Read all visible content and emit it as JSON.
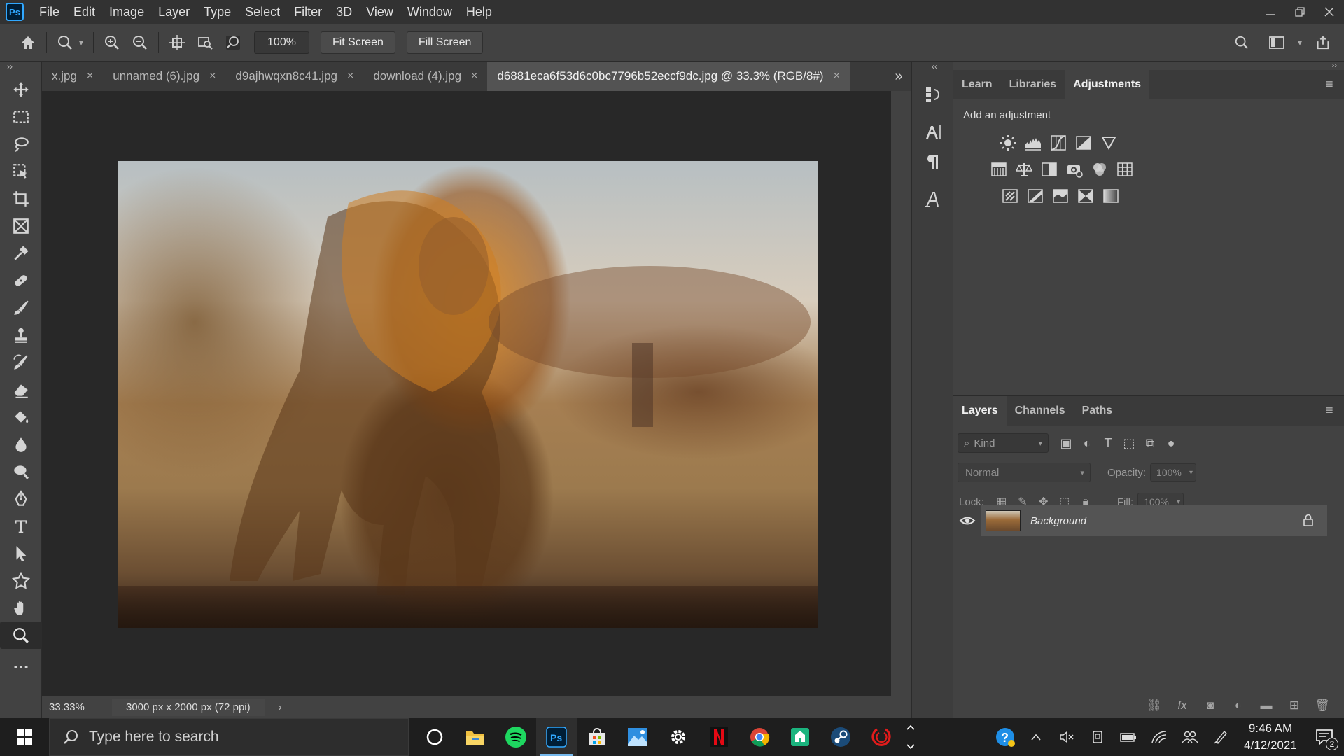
{
  "app": {
    "logo": "Ps"
  },
  "menu": [
    "File",
    "Edit",
    "Image",
    "Layer",
    "Type",
    "Select",
    "Filter",
    "3D",
    "View",
    "Window",
    "Help"
  ],
  "options": {
    "zoom_value": "100%",
    "fit_screen": "Fit Screen",
    "fill_screen": "Fill Screen"
  },
  "tabs": [
    {
      "label": "x.jpg",
      "close": "×"
    },
    {
      "label": "unnamed (6).jpg",
      "close": "×"
    },
    {
      "label": "d9ajhwqxn8c41.jpg",
      "close": "×"
    },
    {
      "label": "download (4).jpg",
      "close": "×"
    },
    {
      "label": "d6881eca6f53d6c0bc7796b52eccf9dc.jpg @ 33.3% (RGB/8#)",
      "close": "×",
      "active": true
    }
  ],
  "status": {
    "zoom": "33.33%",
    "doc_info": "3000 px x 2000 px (72 ppi)",
    "arrow": "›"
  },
  "adjustments": {
    "tabs": [
      "Learn",
      "Libraries",
      "Adjustments"
    ],
    "active_tab": "Adjustments",
    "title": "Add an adjustment"
  },
  "layers": {
    "tabs": [
      "Layers",
      "Channels",
      "Paths"
    ],
    "active_tab": "Layers",
    "kind_placeholder": "Kind",
    "blend_mode": "Normal",
    "opacity_label": "Opacity:",
    "opacity_value": "100%",
    "lock_label": "Lock:",
    "fill_label": "Fill:",
    "fill_value": "100%",
    "items": [
      {
        "name": "Background",
        "visible": true,
        "locked": true
      }
    ]
  },
  "taskbar": {
    "search_placeholder": "Type here to search",
    "time": "9:46 AM",
    "date": "4/12/2021",
    "notification_count": "2"
  },
  "colors": {
    "accent": "#31a8ff",
    "canvas_bg": "#282828",
    "panel_bg": "#424242"
  }
}
